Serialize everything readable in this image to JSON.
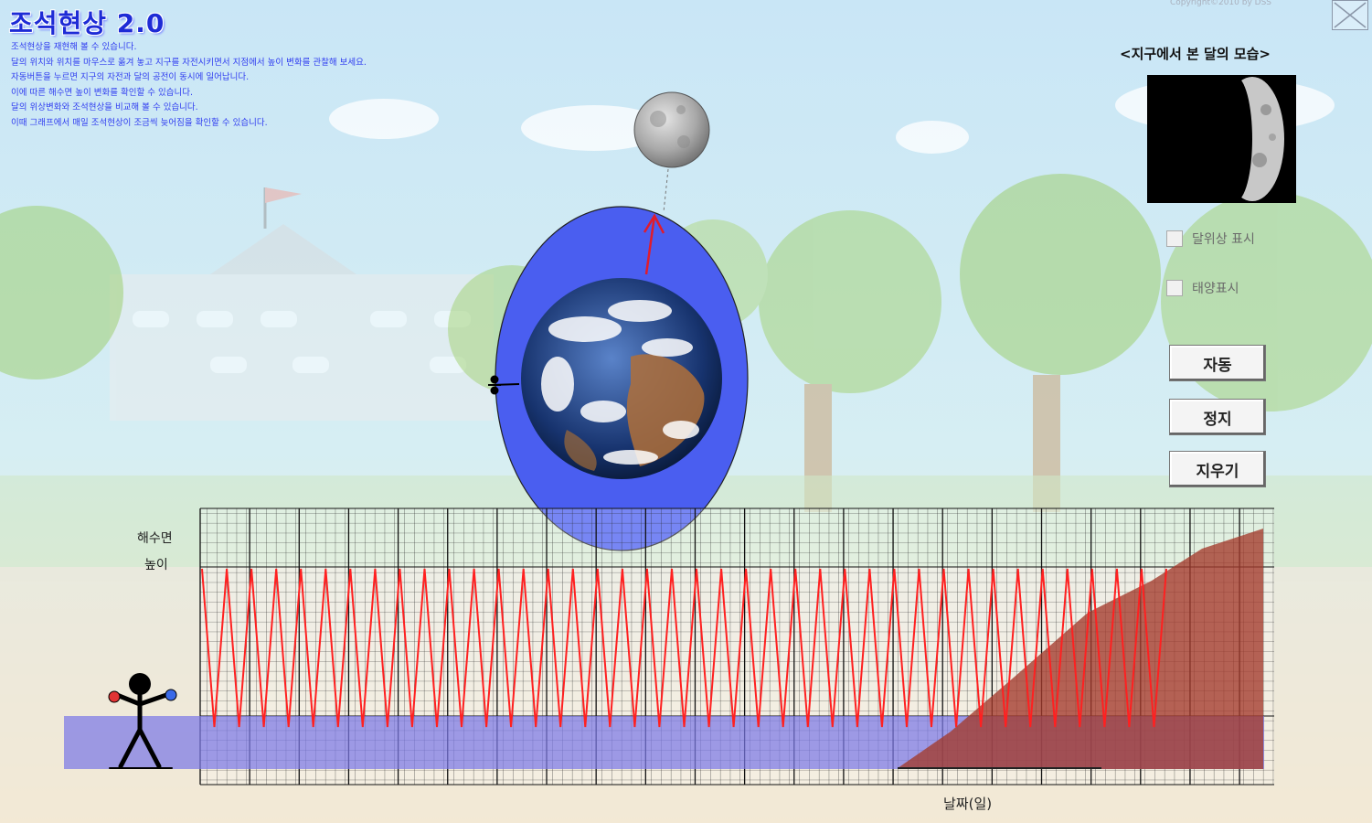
{
  "app": {
    "title": "조석현상 2.0",
    "copyright": "Copyright©2010 by DSS",
    "description_lines": [
      "조석현상을 재현해 볼 수 있습니다.",
      "달의 위치와 위치를 마우스로 옮겨 놓고 지구를 자전시키면서 지점에서 높이 변화를 관찰해 보세요.",
      "자동버튼을 누르면 지구의 자전과 달의 공전이 동시에 일어납니다.",
      "이에 따른 해수면 높이 변화를 확인할 수 있습니다.",
      "달의 위상변화와 조석현상을 비교해 볼 수 있습니다.",
      "이때 그래프에서 매일 조석현상이 조금씩 늦어짐을 확인할 수 있습니다."
    ]
  },
  "moon_panel": {
    "caption": "<지구에서 본 달의 모습>",
    "phase": "waxing-crescent"
  },
  "checkboxes": [
    {
      "label": "달위상 표시",
      "checked": false
    },
    {
      "label": "태양표시",
      "checked": false
    }
  ],
  "buttons": {
    "auto": "자동",
    "stop": "정지",
    "clear": "지우기"
  },
  "graph": {
    "ylabel_line1": "해수면",
    "ylabel_line2": "높이",
    "xlabel": "날짜(일)",
    "tide_cycles": 39,
    "tide_color": "#ff2020"
  },
  "colors": {
    "title": "#1e2bd6",
    "description": "#2f3cf0",
    "ocean_bulge": "#4a5ef0",
    "sea_level": "#9a9af0",
    "land": "#a03a2a"
  }
}
